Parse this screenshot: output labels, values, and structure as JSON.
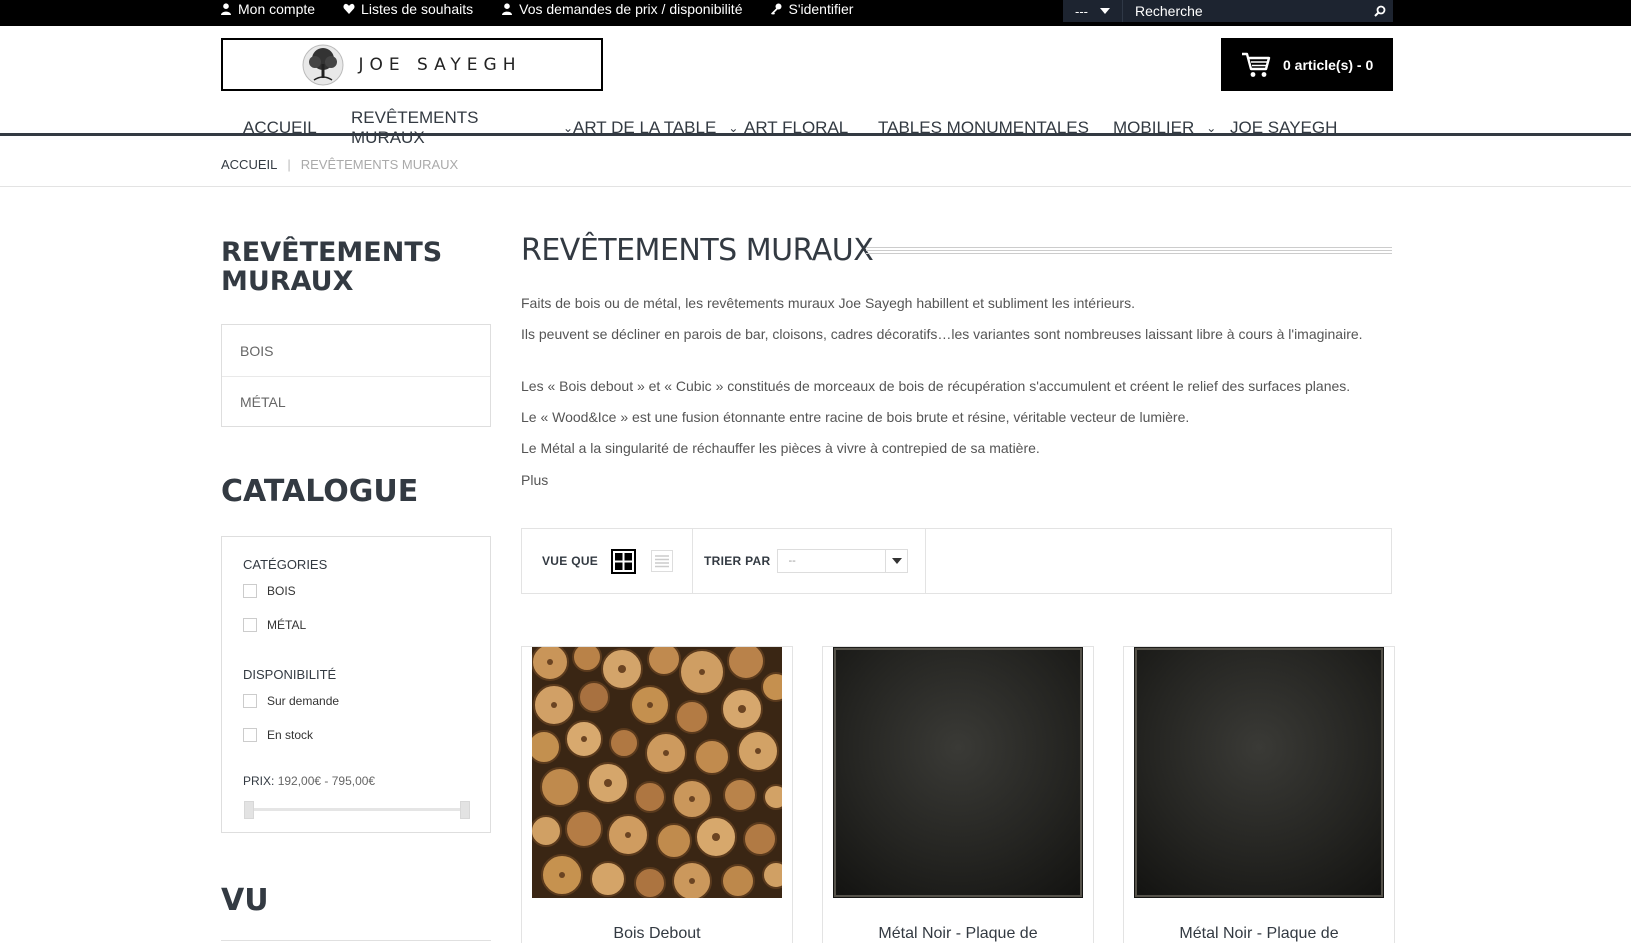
{
  "topbar": {
    "links": [
      {
        "label": "Mon compte",
        "icon": "user-icon"
      },
      {
        "label": "Listes de souhaits",
        "icon": "heart-icon"
      },
      {
        "label": "Vos demandes de prix / disponibilité",
        "icon": "user-icon"
      },
      {
        "label": "S'identifier",
        "icon": "key-icon"
      }
    ],
    "search": {
      "category_value": "---",
      "placeholder": "Recherche"
    }
  },
  "header": {
    "logo_text": "JOE SAYEGH",
    "cart_label": "0 article(s) - 0"
  },
  "nav": {
    "items": [
      {
        "label": "ACCUEIL",
        "has_dropdown": false
      },
      {
        "label": "REVÊTEMENTS MURAUX",
        "has_dropdown": true
      },
      {
        "label": "ART DE LA TABLE",
        "has_dropdown": true
      },
      {
        "label": "ART FLORAL",
        "has_dropdown": false
      },
      {
        "label": "TABLES MONUMENTALES",
        "has_dropdown": false
      },
      {
        "label": "MOBILIER",
        "has_dropdown": true
      },
      {
        "label": "JOE SAYEGH",
        "has_dropdown": false
      }
    ]
  },
  "breadcrumb": {
    "home": "ACCUEIL",
    "separator": "|",
    "current": "REVÊTEMENTS MURAUX"
  },
  "sidebar": {
    "category_title": "REVÊTEMENTS MURAUX",
    "subcategories": [
      "BOIS",
      "MÉTAL"
    ],
    "catalogue_title": "CATALOGUE",
    "filters": {
      "categories_heading": "CATÉGORIES",
      "categories": [
        "BOIS",
        "MÉTAL"
      ],
      "availability_heading": "DISPONIBILITÉ",
      "availability": [
        "Sur demande",
        "En stock"
      ],
      "price_label": "PRIX:",
      "price_range": "192,00€ - 795,00€"
    },
    "viewed_title": "VU"
  },
  "main": {
    "title": "REVÊTEMENTS MURAUX",
    "description": [
      "Faits de bois ou de métal, les revêtements muraux Joe Sayegh habillent et subliment les intérieurs.",
      "Ils peuvent se décliner en parois de bar, cloisons, cadres décoratifs…les variantes sont nombreuses laissant libre à cours à l'imaginaire.",
      "Les « Bois debout » et « Cubic » constitués de morceaux de bois de récupération s'accumulent et créent le relief des surfaces planes.",
      "Le « Wood&Ice »  est une fusion étonnante entre racine de bois brute et résine, véritable vecteur de lumière.",
      "Le Métal a la singularité de réchauffer les pièces à vivre à contrepied de sa matière."
    ],
    "more_label": "Plus",
    "toolbar": {
      "view_label": "VUE QUE",
      "sort_label": "TRIER PAR",
      "sort_value": "--"
    },
    "products": [
      {
        "name": "Bois Debout"
      },
      {
        "name": "Métal Noir - Plaque de"
      },
      {
        "name": "Métal Noir - Plaque de"
      }
    ]
  },
  "colors": {
    "dark": "#333a42",
    "topbar": "#000000",
    "search_bg": "#1d2430"
  }
}
